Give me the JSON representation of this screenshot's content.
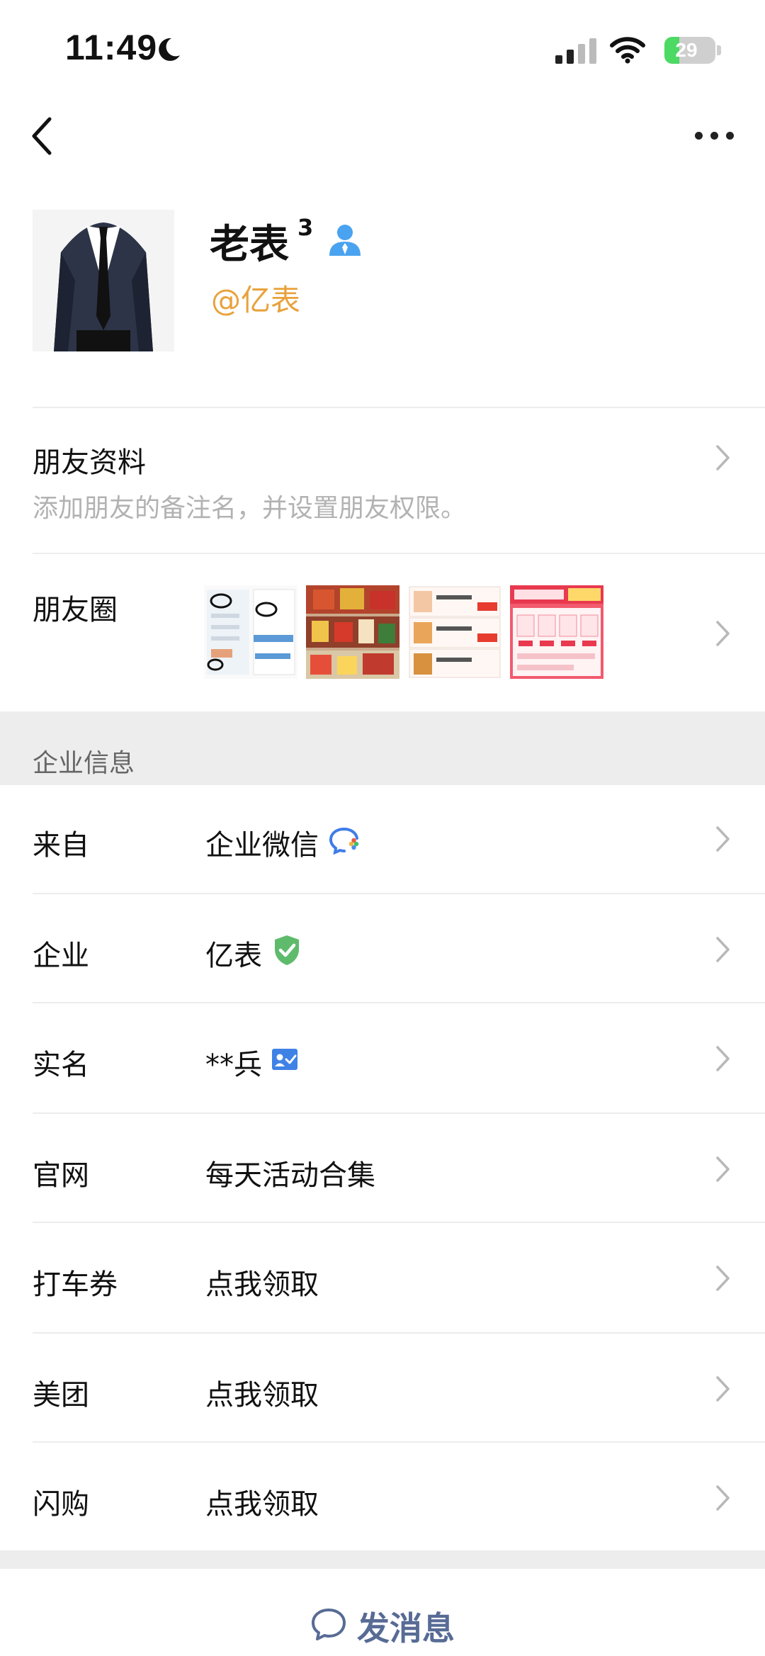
{
  "status_bar": {
    "time": "11:49",
    "battery": "29",
    "battery_level": 0.29
  },
  "nav": {
    "back_icon": "chevron-left-icon",
    "more_icon": "more-dots-icon"
  },
  "profile": {
    "name": "老表",
    "name_suffix": "3",
    "handle": "@亿表",
    "contact_icon": "person-icon"
  },
  "friend_info": {
    "title": "朋友资料",
    "subtitle": "添加朋友的备注名，并设置朋友权限。"
  },
  "moments": {
    "title": "朋友圈"
  },
  "enterprise": {
    "section_label": "企业信息",
    "rows": [
      {
        "label": "来自",
        "value": "企业微信",
        "icon": "wecom-icon"
      },
      {
        "label": "企业",
        "value": "亿表",
        "icon": "verified-shield-icon"
      },
      {
        "label": "实名",
        "value": "**兵",
        "icon": "id-card-icon"
      },
      {
        "label": "官网",
        "value": "每天活动合集"
      },
      {
        "label": "打车券",
        "value": "点我领取"
      },
      {
        "label": "美团",
        "value": "点我领取"
      },
      {
        "label": "闪购",
        "value": "点我领取"
      }
    ]
  },
  "footer": {
    "send_label": "发消息"
  },
  "colors": {
    "accent_orange": "#e8a23c",
    "link_blue": "#576b95",
    "verified_green": "#5fbb6c",
    "icon_blue": "#4aa3f0"
  }
}
